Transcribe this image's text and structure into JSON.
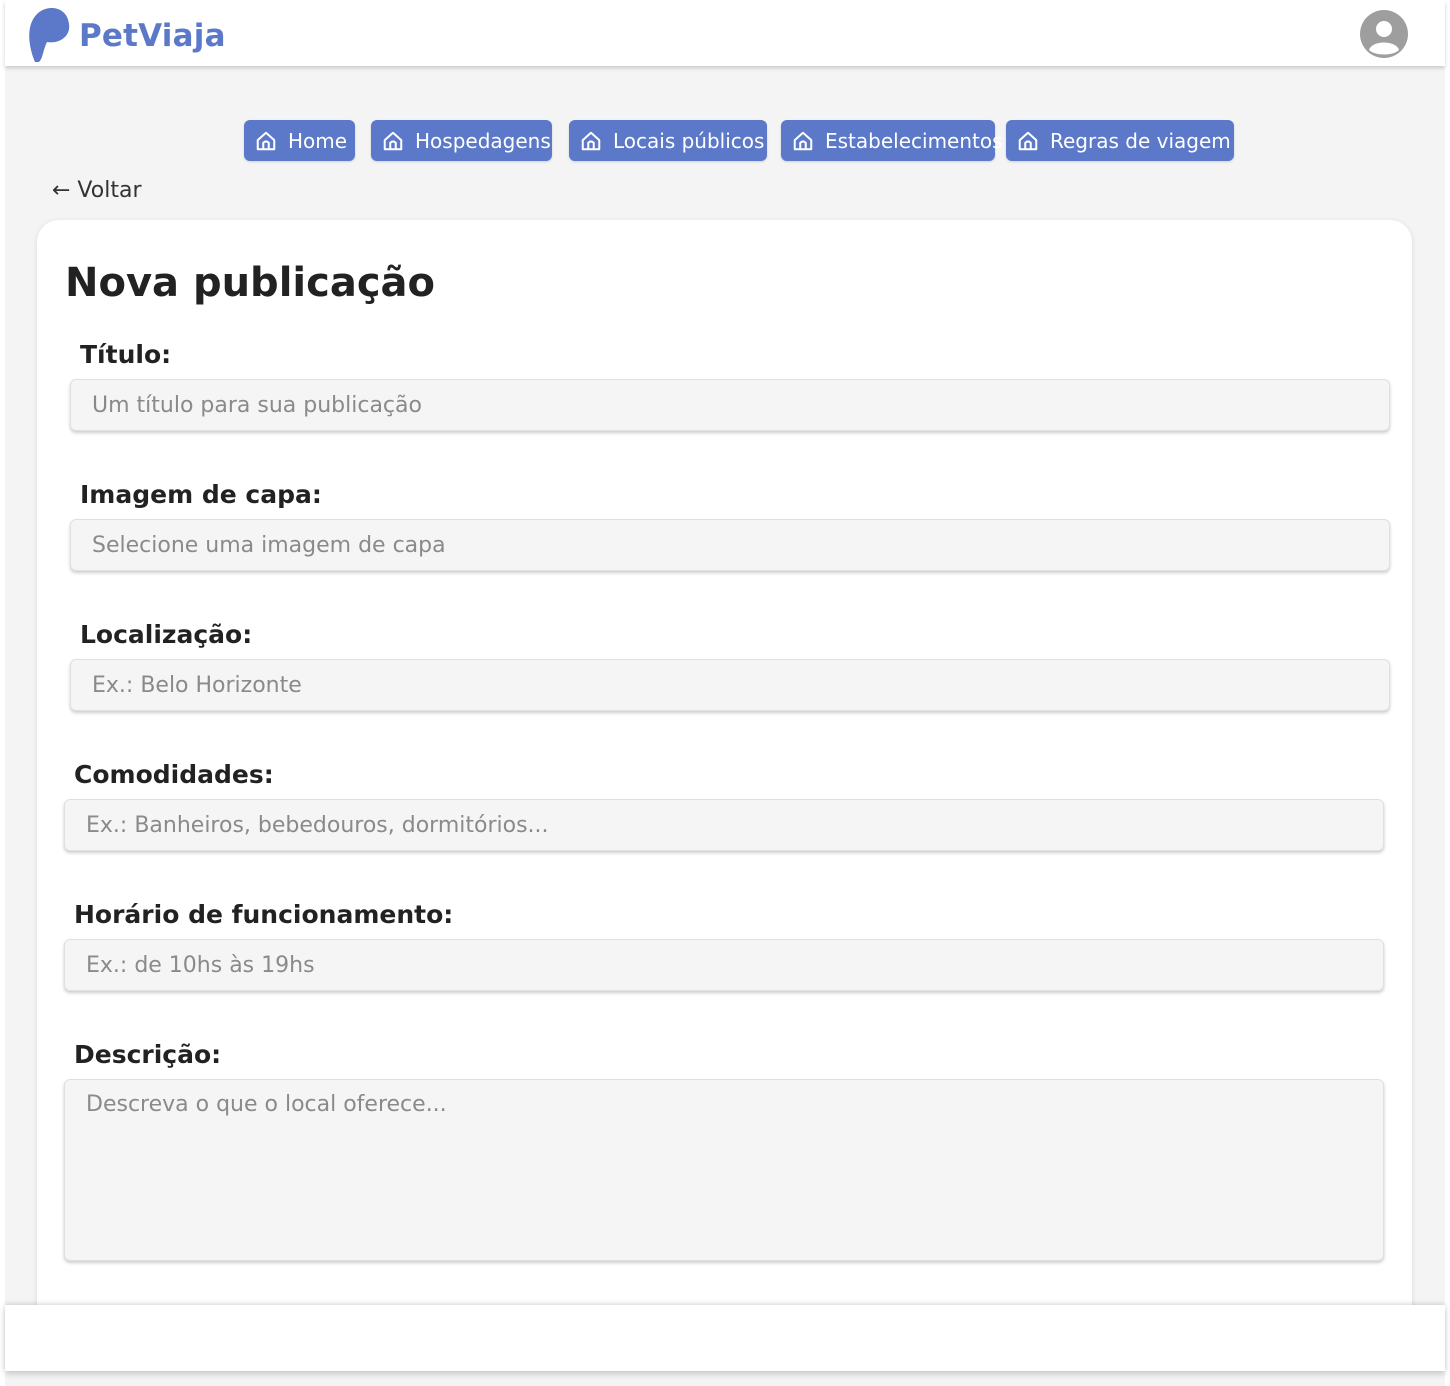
{
  "header": {
    "brand": "PetViaja",
    "brand_color": "#5b78c9",
    "logo_icon": "paw-logo-icon",
    "avatar_icon": "user-avatar-icon"
  },
  "nav": {
    "items": [
      {
        "label": "Home",
        "icon": "home-icon"
      },
      {
        "label": "Hospedagens",
        "icon": "home-icon"
      },
      {
        "label": "Locais públicos",
        "icon": "home-icon"
      },
      {
        "label": "Estabelecimentos",
        "icon": "home-icon"
      },
      {
        "label": "Regras de viagem",
        "icon": "home-icon"
      }
    ]
  },
  "back": {
    "label": "← Voltar"
  },
  "form": {
    "title": "Nova publicação",
    "fields": {
      "titulo": {
        "label": "Título:",
        "placeholder": "Um título para sua publicação"
      },
      "imagem": {
        "label": "Imagem de capa:",
        "placeholder": "Selecione uma imagem de capa"
      },
      "localizacao": {
        "label": "Localização:",
        "placeholder": "Ex.: Belo Horizonte"
      },
      "comodidades": {
        "label": "Comodidades:",
        "placeholder": "Ex.: Banheiros, bebedouros, dormitórios..."
      },
      "horario": {
        "label": "Horário de funcionamento:",
        "placeholder": "Ex.: de 10hs às 19hs"
      },
      "descricao": {
        "label": "Descrição:",
        "placeholder": "Descreva o que o local oferece..."
      }
    }
  }
}
